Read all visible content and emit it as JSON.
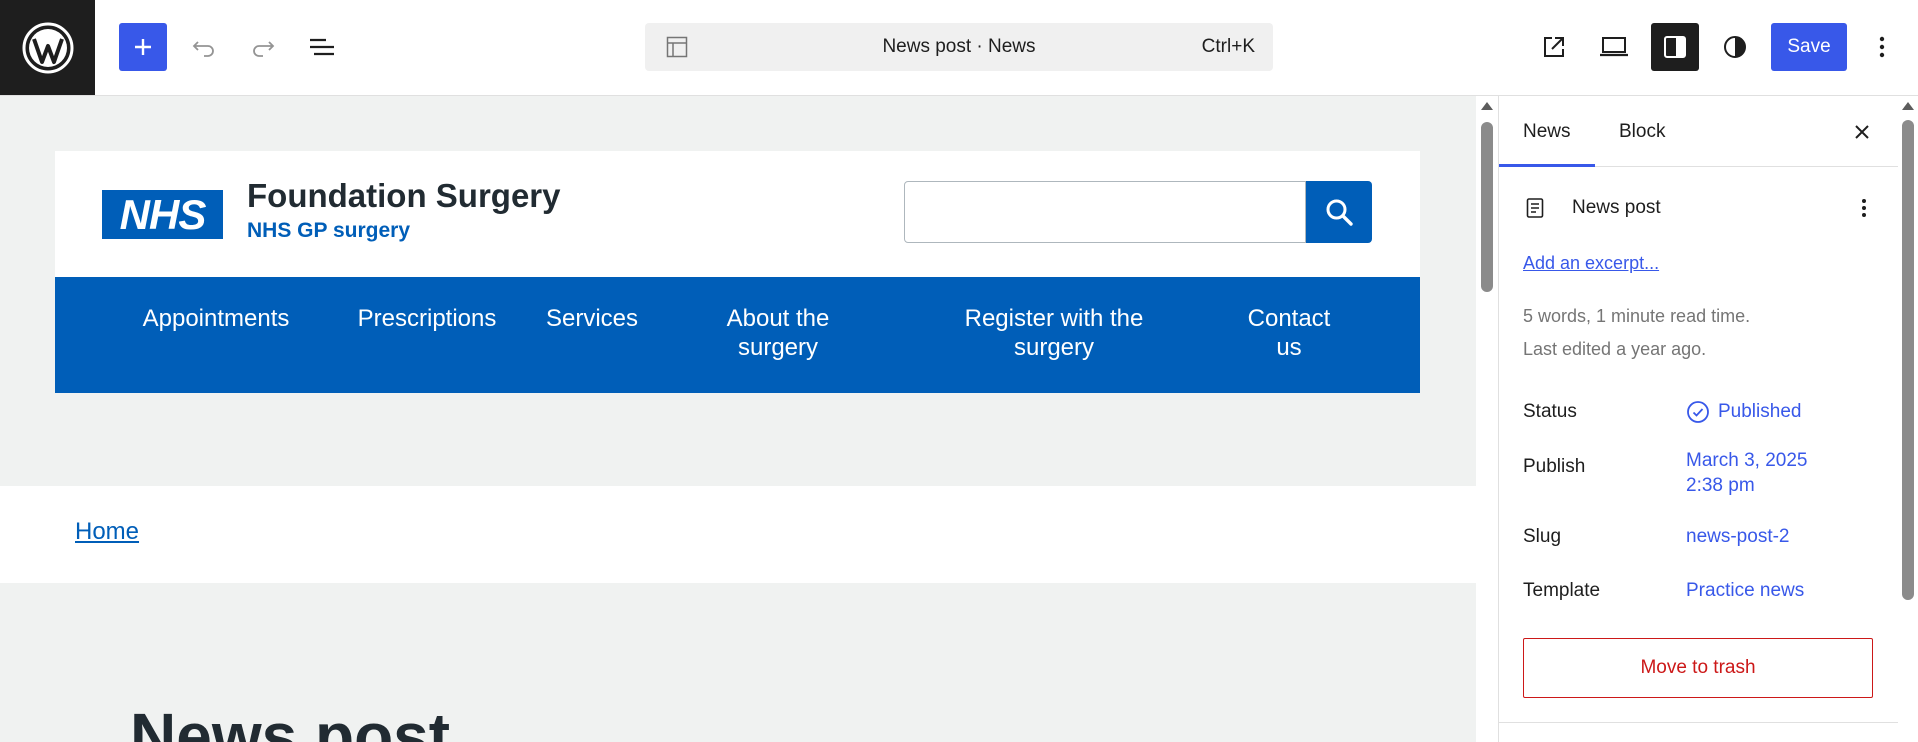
{
  "toolbar": {
    "logo_icon": "wordpress-logo-icon",
    "add_icon": "plus-icon",
    "undo_icon": "undo-icon",
    "redo_icon": "redo-icon",
    "list_view_icon": "list-view-icon",
    "command_bar": {
      "template_icon": "layout-icon",
      "title": "News post · News",
      "shortcut": "Ctrl+K"
    },
    "view_icon": "external-link-icon",
    "device_icon": "laptop-icon",
    "settings_icon": "sidebar-icon",
    "styles_icon": "contrast-icon",
    "save_label": "Save",
    "options_icon": "vertical-ellipsis-icon",
    "accent_color": "#3858e9"
  },
  "canvas": {
    "header": {
      "logo_text": "NHS",
      "title": "Foundation Surgery",
      "subtitle": "NHS GP surgery",
      "search_icon": "search-icon",
      "brand_color": "#005eb8"
    },
    "nav": [
      "Appointments",
      "Prescriptions",
      "Services",
      "About the surgery",
      "Register with the surgery",
      "Contact us"
    ],
    "breadcrumb": "Home",
    "post_title": "News post"
  },
  "sidebar": {
    "tabs": [
      "News",
      "Block"
    ],
    "active_tab": "News",
    "close_icon": "close-icon",
    "post_card": {
      "icon": "document-icon",
      "title": "News post",
      "more_icon": "vertical-ellipsis-icon"
    },
    "excerpt_link": "Add an excerpt...",
    "meta": {
      "read_time": "5 words, 1 minute read time.",
      "last_edited": "Last edited a year ago."
    },
    "rows": [
      {
        "label": "Status",
        "value": "Published"
      },
      {
        "label": "Publish",
        "value": "March 3, 2025",
        "value2": "2:38 pm"
      },
      {
        "label": "Slug",
        "value": "news-post-2"
      },
      {
        "label": "Template",
        "value": "Practice news"
      }
    ],
    "trash_label": "Move to trash",
    "danger_color": "#cc1818"
  }
}
